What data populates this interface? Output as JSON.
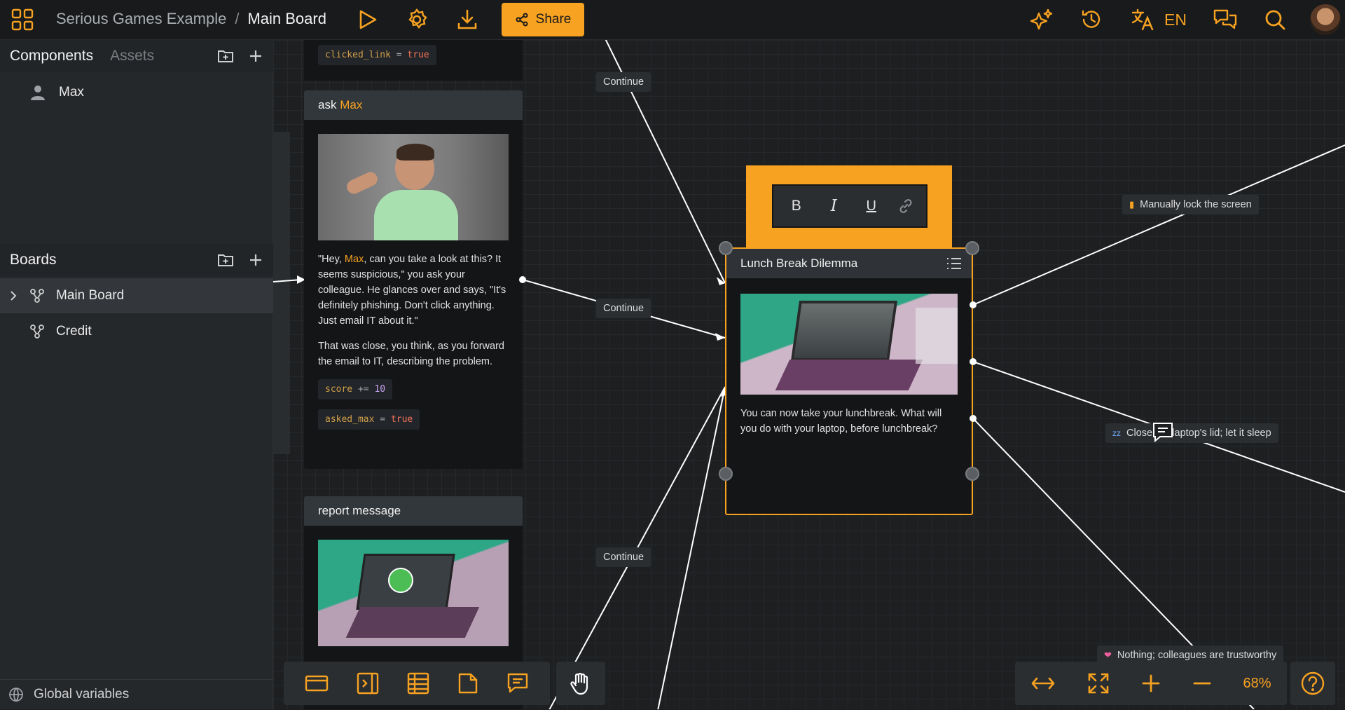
{
  "header": {
    "project": "Serious Games Example",
    "separator": "/",
    "board": "Main Board",
    "share_label": "Share",
    "language": "EN"
  },
  "sidebar": {
    "components_tab": "Components",
    "assets_tab": "Assets",
    "components": [
      {
        "label": "Max",
        "icon": "person-icon"
      }
    ],
    "boards_title": "Boards",
    "boards": [
      {
        "label": "Main Board",
        "icon": "board-icon",
        "selected": true
      },
      {
        "label": "Credit",
        "icon": "board-icon",
        "selected": false
      }
    ],
    "global_variables": "Global variables"
  },
  "nodes": {
    "top_var": {
      "name": "clicked_link",
      "op": "=",
      "value": "true"
    },
    "ask": {
      "title_prefix": "ask",
      "title_name": "Max",
      "p1_a": "\"Hey, ",
      "p1_name": "Max",
      "p1_b": ", can you take a look at this? It seems suspicious,\" you ask your colleague. He glances over and says, \"It's definitely phishing. Don't click anything. Just email IT about it.\"",
      "p2": "That was close, you think, as you forward the email to IT, describing the problem.",
      "score": {
        "name": "score",
        "op": "+=",
        "value": "10"
      },
      "asked": {
        "name": "asked_max",
        "op": "=",
        "value": "true"
      }
    },
    "report": {
      "title": "report message"
    },
    "lunch": {
      "title": "Lunch Break Dilemma",
      "text": "You can now take your lunchbreak. What will you do with your laptop, before lunchbreak?"
    }
  },
  "edges": {
    "continue_labels": [
      "Continue",
      "Continue",
      "Continue"
    ]
  },
  "choices": {
    "lock": "Manually lock the screen",
    "close": "Close the laptop's lid; let it sleep",
    "nothing": "Nothing; colleagues are trustworthy"
  },
  "format_toolbar": {
    "bold": "B",
    "italic": "I",
    "underline": "U"
  },
  "zoom": {
    "level": "68%"
  },
  "colors": {
    "accent": "#f7a221",
    "background": "#1d1f21",
    "node_header": "#32373b"
  }
}
